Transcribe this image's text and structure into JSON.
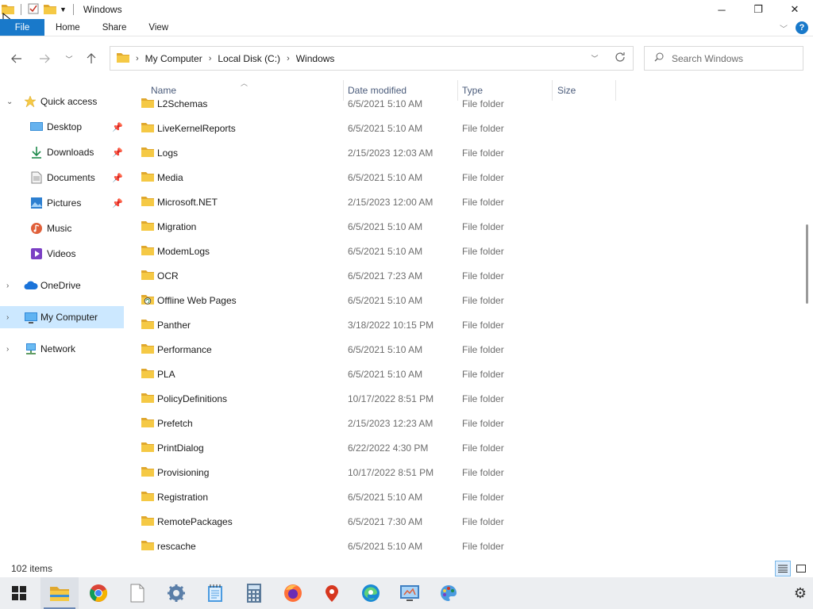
{
  "window": {
    "title": "Windows",
    "minimize_glyph": "─",
    "maximize_glyph": "❐",
    "close_glyph": "✕"
  },
  "ribbon": {
    "tabs": [
      "File",
      "Home",
      "Share",
      "View"
    ],
    "help_glyph": "?"
  },
  "address": {
    "crumbs": [
      "My Computer",
      "Local Disk (C:)",
      "Windows"
    ],
    "search_placeholder": "Search Windows"
  },
  "nav": {
    "items": [
      {
        "label": "Quick access",
        "icon": "star-icon"
      },
      {
        "label": "Desktop",
        "icon": "desktop-icon",
        "pinned": true
      },
      {
        "label": "Downloads",
        "icon": "download-icon",
        "pinned": true
      },
      {
        "label": "Documents",
        "icon": "document-icon",
        "pinned": true
      },
      {
        "label": "Pictures",
        "icon": "pictures-icon",
        "pinned": true
      },
      {
        "label": "Music",
        "icon": "music-icon"
      },
      {
        "label": "Videos",
        "icon": "videos-icon"
      },
      {
        "label": "OneDrive",
        "icon": "cloud-icon"
      },
      {
        "label": "My Computer",
        "icon": "computer-icon",
        "selected": true
      },
      {
        "label": "Network",
        "icon": "network-icon"
      }
    ]
  },
  "list": {
    "columns": [
      "Name",
      "Date modified",
      "Type",
      "Size"
    ],
    "rows": [
      {
        "name": "L2Schemas",
        "date": "6/5/2021 5:10 AM",
        "type": "File folder"
      },
      {
        "name": "LiveKernelReports",
        "date": "6/5/2021 5:10 AM",
        "type": "File folder"
      },
      {
        "name": "Logs",
        "date": "2/15/2023 12:03 AM",
        "type": "File folder"
      },
      {
        "name": "Media",
        "date": "6/5/2021 5:10 AM",
        "type": "File folder"
      },
      {
        "name": "Microsoft.NET",
        "date": "2/15/2023 12:00 AM",
        "type": "File folder"
      },
      {
        "name": "Migration",
        "date": "6/5/2021 5:10 AM",
        "type": "File folder"
      },
      {
        "name": "ModemLogs",
        "date": "6/5/2021 5:10 AM",
        "type": "File folder"
      },
      {
        "name": "OCR",
        "date": "6/5/2021 7:23 AM",
        "type": "File folder"
      },
      {
        "name": "Offline Web Pages",
        "date": "6/5/2021 5:10 AM",
        "type": "File folder",
        "special": true
      },
      {
        "name": "Panther",
        "date": "3/18/2022 10:15 PM",
        "type": "File folder"
      },
      {
        "name": "Performance",
        "date": "6/5/2021 5:10 AM",
        "type": "File folder"
      },
      {
        "name": "PLA",
        "date": "6/5/2021 5:10 AM",
        "type": "File folder"
      },
      {
        "name": "PolicyDefinitions",
        "date": "10/17/2022 8:51 PM",
        "type": "File folder"
      },
      {
        "name": "Prefetch",
        "date": "2/15/2023 12:23 AM",
        "type": "File folder"
      },
      {
        "name": "PrintDialog",
        "date": "6/22/2022 4:30 PM",
        "type": "File folder"
      },
      {
        "name": "Provisioning",
        "date": "10/17/2022 8:51 PM",
        "type": "File folder"
      },
      {
        "name": "Registration",
        "date": "6/5/2021 5:10 AM",
        "type": "File folder"
      },
      {
        "name": "RemotePackages",
        "date": "6/5/2021 7:30 AM",
        "type": "File folder"
      },
      {
        "name": "rescache",
        "date": "6/5/2021 5:10 AM",
        "type": "File folder"
      }
    ]
  },
  "status": {
    "item_count": "102 items"
  },
  "taskbar": {
    "apps": [
      "start-icon",
      "file-explorer-icon",
      "chrome-icon",
      "blank-file-icon",
      "settings-gear-icon",
      "notepad-icon",
      "calculator-icon",
      "firefox-icon",
      "maps-icon",
      "edge-icon",
      "control-panel-icon",
      "paint-icon"
    ]
  },
  "colors": {
    "accent": "#1979ca",
    "folder": "#f5c945",
    "folder_dark": "#e0a82e",
    "selected": "#cce8ff"
  }
}
